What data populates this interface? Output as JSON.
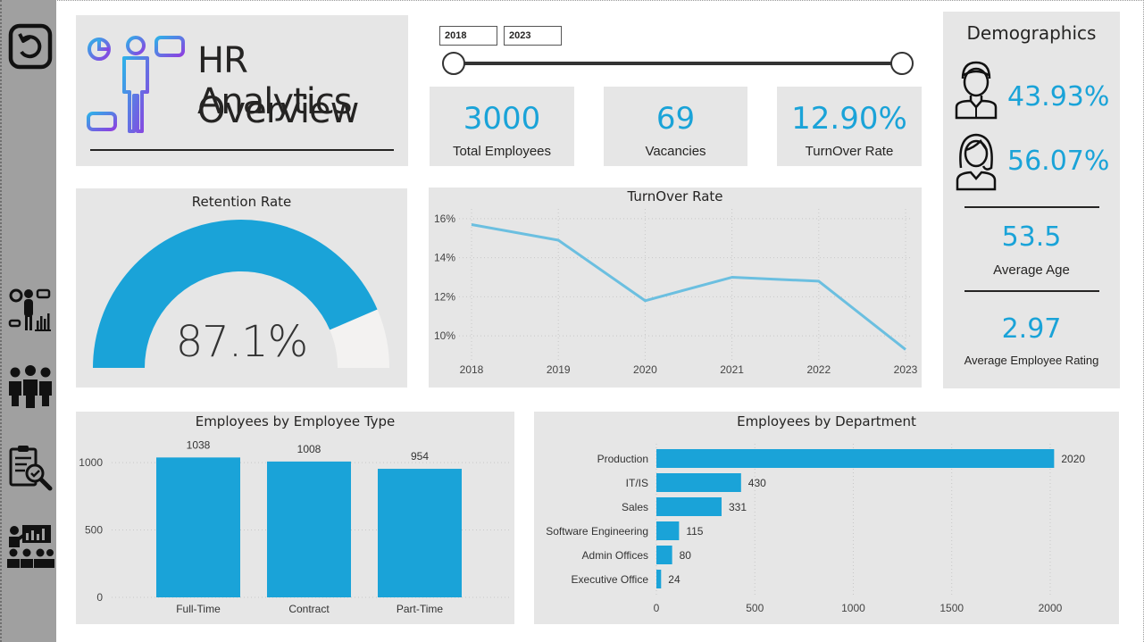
{
  "sidebar": {
    "items": [
      {
        "name": "back-icon"
      },
      {
        "name": "overview-nav-icon"
      },
      {
        "name": "employees-nav-icon"
      },
      {
        "name": "performance-review-icon"
      },
      {
        "name": "training-nav-icon"
      }
    ]
  },
  "header": {
    "title_line1": "HR Analytics",
    "title_line2": "Overview"
  },
  "slicer": {
    "start": "2018",
    "end": "2023"
  },
  "kpis": [
    {
      "value": "3000",
      "label": "Total Employees"
    },
    {
      "value": "69",
      "label": "Vacancies"
    },
    {
      "value": "12.90%",
      "label": "TurnOver Rate"
    }
  ],
  "demographics": {
    "title": "Demographics",
    "male_pct": "43.93%",
    "female_pct": "56.07%",
    "avg_age": "53.5",
    "avg_age_label": "Average Age",
    "avg_rating": "2.97",
    "avg_rating_label": "Average Employee Rating"
  },
  "retention": {
    "title": "Retention Rate",
    "value_text": "87.1%",
    "value": 87.1
  },
  "colors": {
    "accent": "#1aa3d8",
    "line": "#6bbfe0",
    "card": "#e6e6e6",
    "sidebar": "#a0a0a0"
  },
  "chart_data": [
    {
      "type": "line",
      "title": "TurnOver Rate",
      "x": [
        "2018",
        "2019",
        "2020",
        "2021",
        "2022",
        "2023"
      ],
      "series": [
        {
          "values": [
            15.7,
            14.9,
            11.8,
            13.0,
            12.8,
            9.3
          ]
        }
      ],
      "ylim": [
        9,
        16.5
      ],
      "yticks": [
        10,
        12,
        14,
        16
      ],
      "ytick_labels": [
        "10%",
        "12%",
        "14%",
        "16%"
      ],
      "grid": true
    },
    {
      "type": "bar",
      "title": "Employees by Employee Type",
      "categories": [
        "Full-Time",
        "Contract",
        "Part-Time"
      ],
      "values": [
        1038,
        1008,
        954
      ],
      "ylim": [
        0,
        1100
      ],
      "yticks": [
        0,
        500,
        1000
      ],
      "data_labels": true
    },
    {
      "type": "bar",
      "orientation": "horizontal",
      "title": "Employees by Department",
      "categories": [
        "Production",
        "IT/IS",
        "Sales",
        "Software Engineering",
        "Admin Offices",
        "Executive Office"
      ],
      "values": [
        2020,
        430,
        331,
        115,
        80,
        24
      ],
      "xlim": [
        0,
        2100
      ],
      "xticks": [
        0,
        500,
        1000,
        1500,
        2000
      ],
      "data_labels": true
    }
  ]
}
